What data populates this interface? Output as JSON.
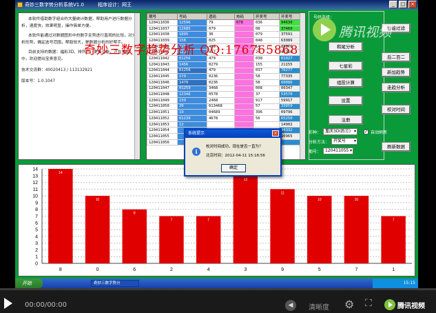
{
  "window": {
    "title": "奇妙三数字势分析系统V1.0",
    "designer": "程序设计：网王",
    "btn_min": "_",
    "btn_max": "□",
    "btn_close": "×"
  },
  "left_text": {
    "paragraphs": [
      "本软件借助数字组合的大量统计数据，帮助用户进行数据分析，速度快，效果明显，操作简单方便。",
      "本软件能通过对数据图形中的数字走势进行直观的比较，对分析形势，确定选号范围，帮助较大，是数据分析的好帮手。",
      "目前支持的数据：福彩3D、排列三。更多功能，正在开发中，欢迎提出宝贵意见。"
    ],
    "qq_line": "技术交流群：40020413 / 113132921",
    "version_line": "版本号：1.0.1047"
  },
  "watermark": "奇妙三数字趋势分析   QQ:176765868",
  "grid": {
    "headers": [
      "期号",
      "号码",
      "遗码",
      "热码",
      "开奖号",
      "开奖号"
    ],
    "rows": [
      [
        "120411036",
        "12596",
        "79",
        "078",
        "036",
        "94630"
      ],
      [
        "120411037",
        "12685",
        "079",
        "",
        "08",
        "37460"
      ],
      [
        "120411038",
        "1895",
        "36",
        "",
        "079",
        "37591"
      ],
      [
        "120411039",
        "158",
        "025",
        "",
        "048",
        "63089"
      ],
      [
        "120411040",
        "126",
        "489",
        "",
        "14",
        "85076"
      ],
      [
        "120411041",
        "128",
        "457",
        "",
        "24",
        "41250"
      ],
      [
        "120411042",
        "01256",
        "479",
        "",
        "038",
        "01027"
      ],
      [
        "120411043",
        "1456",
        "0279",
        "",
        "155",
        "21155"
      ],
      [
        "120411044",
        "01256",
        "479",
        "",
        "037",
        "70277"
      ],
      [
        "120411045",
        "179",
        "0236",
        "",
        "58",
        "77335"
      ],
      [
        "120411046",
        "1479",
        "0236",
        "",
        "58",
        "60086"
      ],
      [
        "120411047",
        "01259",
        "3468",
        "",
        "008",
        "00347"
      ],
      [
        "120411048",
        "12346",
        "0578",
        "",
        "37",
        "53570"
      ],
      [
        "120411049",
        "139",
        "2468",
        "",
        "917",
        "59917"
      ],
      [
        "120411050",
        "29",
        "013468",
        "",
        "57",
        "33059"
      ],
      [
        "120411051",
        "19",
        "04689",
        "",
        "396",
        "09796"
      ],
      [
        "120411052",
        "01239",
        "4678",
        "",
        "56",
        "65250"
      ],
      [
        "120411053",
        "12",
        "",
        "",
        "",
        "14902"
      ],
      [
        "120411054",
        "",
        "",
        "",
        "",
        "94332"
      ],
      [
        "120411055",
        "",
        "",
        "",
        "",
        "90965"
      ],
      [
        "120411056",
        "",
        "",
        "",
        "",
        ""
      ]
    ]
  },
  "panel": {
    "label": "号码选择：",
    "btn_set": "和尾分析",
    "btn_seven": "七星彩",
    "btn_calc": "组投计算",
    "btn_settings": "设置",
    "btn_register": "注册"
  },
  "side_buttons": {
    "auto_filter": "智能过滤",
    "last_two": "后二百二",
    "new_trend": "新加趋势",
    "trend_analysis": "走趋分析",
    "calibrate": "校对时间"
  },
  "controls": {
    "type_label": "彩种：",
    "type_value": "重庆3D(后三)",
    "auto_label": "自动刷新",
    "auto_checked": "✓",
    "method_label": "分析方法：",
    "method_value": "开奖号",
    "period_label": "期号：",
    "period_value": "120411055",
    "refresh_btn": "刷新数据"
  },
  "chart_data": {
    "type": "bar",
    "categories": [
      "8",
      "0",
      "6",
      "2",
      "4",
      "3",
      "9",
      "5",
      "7",
      "1"
    ],
    "values": [
      14,
      10,
      8,
      7,
      7,
      13,
      11,
      10,
      10,
      7
    ],
    "ylim": [
      0,
      14
    ],
    "yticks": [
      0,
      1,
      2,
      3,
      4,
      5,
      6,
      7,
      8,
      9,
      10,
      11,
      12,
      13,
      14
    ],
    "grid": true,
    "bar_color": "#e00000"
  },
  "dialog": {
    "title": "系统提示",
    "message1": "校对时间成功，现在是否一直为？",
    "message2": "北京时间：2012-04-11 15:16:56",
    "ok": "确定",
    "icon": "i"
  },
  "taskbar": {
    "start": "开始",
    "task": "奇妙三数字势分",
    "clock": "15:15"
  },
  "tencent": {
    "logo_text": "腾讯视频"
  },
  "player": {
    "time": "00:00/00:00",
    "quality": "清晰度",
    "brand": "腾讯视频"
  }
}
